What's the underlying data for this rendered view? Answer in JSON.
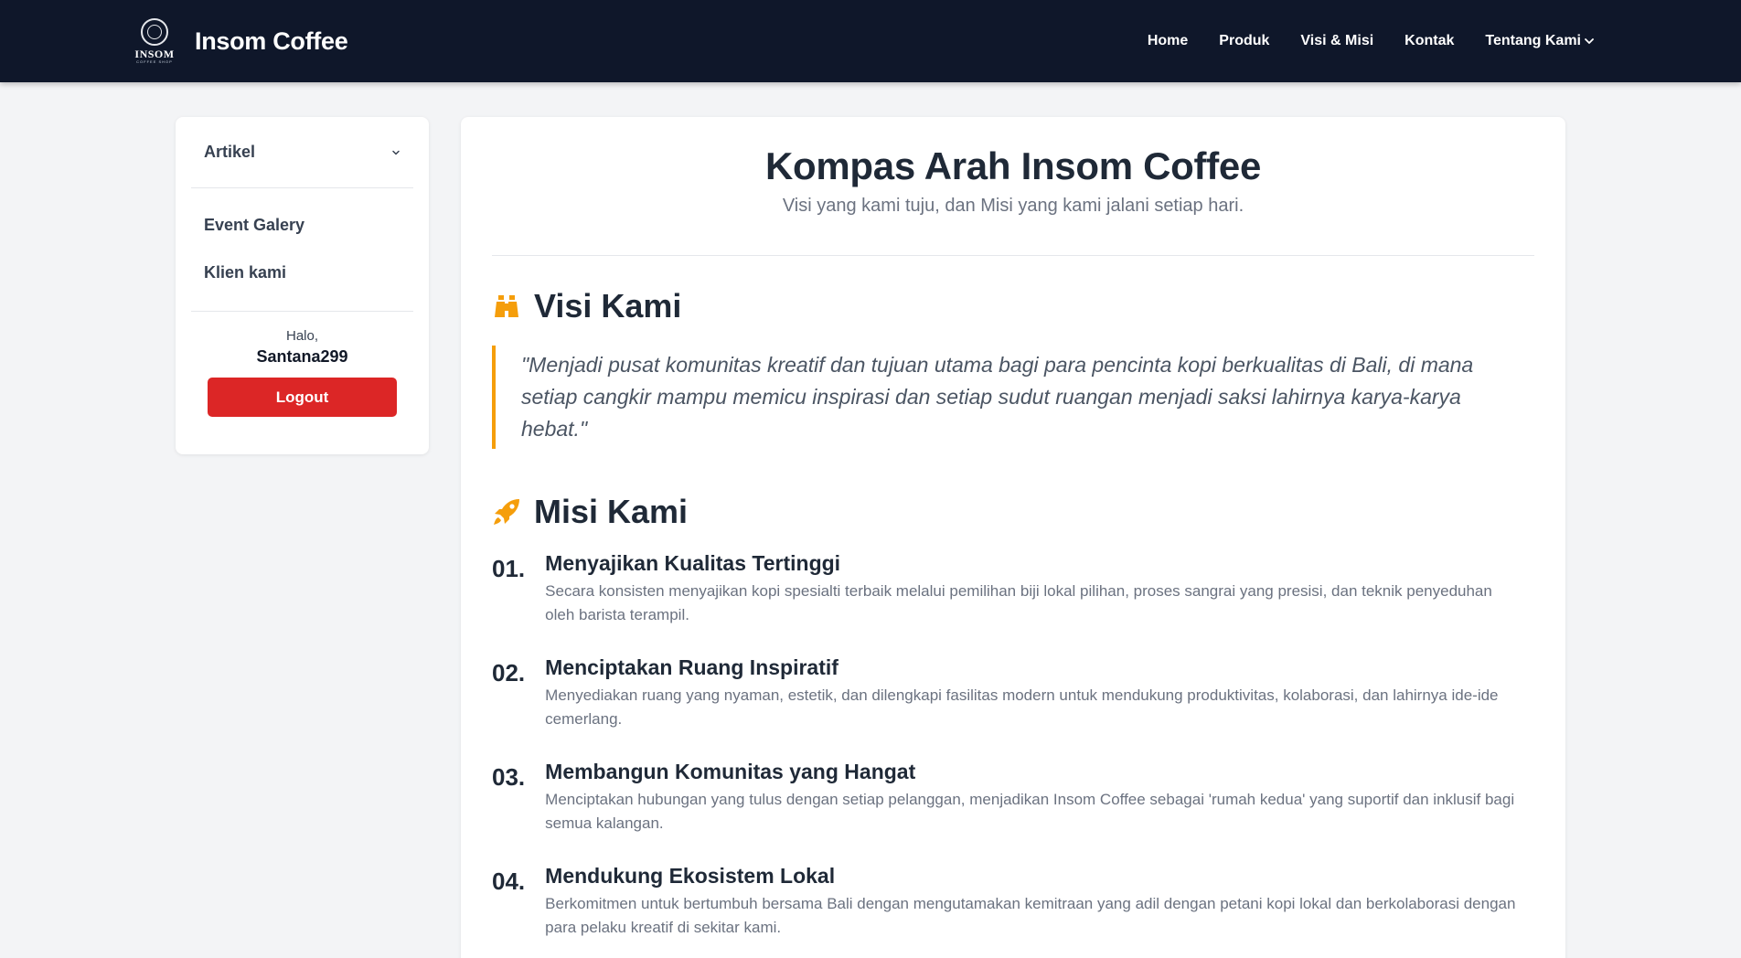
{
  "navbar": {
    "logo_text": "INSOM",
    "logo_sub": "COFFEE SHOP",
    "brand": "Insom Coffee",
    "links": [
      "Home",
      "Produk",
      "Visi & Misi",
      "Kontak",
      "Tentang Kami"
    ]
  },
  "sidebar": {
    "artikel": "Artikel",
    "links": [
      "Event Galery",
      "Klien kami"
    ],
    "hello": "Halo,",
    "username": "Santana299",
    "logout": "Logout"
  },
  "main": {
    "title": "Kompas Arah Insom Coffee",
    "subtitle": "Visi yang kami tuju, dan Misi yang kami jalani setiap hari.",
    "visi_title": "Visi Kami",
    "visi_quote": "\"Menjadi pusat komunitas kreatif dan tujuan utama bagi para pencinta kopi berkualitas di Bali, di mana setiap cangkir mampu memicu inspirasi dan setiap sudut ruangan menjadi saksi lahirnya karya-karya hebat.\"",
    "misi_title": "Misi Kami",
    "missions": [
      {
        "num": "01.",
        "title": "Menyajikan Kualitas Tertinggi",
        "desc": "Secara konsisten menyajikan kopi spesialti terbaik melalui pemilihan biji lokal pilihan, proses sangrai yang presisi, dan teknik penyeduhan oleh barista terampil."
      },
      {
        "num": "02.",
        "title": "Menciptakan Ruang Inspiratif",
        "desc": "Menyediakan ruang yang nyaman, estetik, dan dilengkapi fasilitas modern untuk mendukung produktivitas, kolaborasi, dan lahirnya ide-ide cemerlang."
      },
      {
        "num": "03.",
        "title": "Membangun Komunitas yang Hangat",
        "desc": "Menciptakan hubungan yang tulus dengan setiap pelanggan, menjadikan Insom Coffee sebagai 'rumah kedua' yang suportif dan inklusif bagi semua kalangan."
      },
      {
        "num": "04.",
        "title": "Mendukung Ekosistem Lokal",
        "desc": "Berkomitmen untuk bertumbuh bersama Bali dengan mengutamakan kemitraan yang adil dengan petani kopi lokal dan berkolaborasi dengan para pelaku kreatif di sekitar kami."
      }
    ]
  },
  "colors": {
    "navbar_bg": "#0f172a",
    "accent": "#f59e0b",
    "logout": "#dc2626"
  },
  "icons": {
    "visi": "binoculars-icon",
    "misi": "rocket-icon",
    "dropdown": "chevron-down-icon"
  }
}
